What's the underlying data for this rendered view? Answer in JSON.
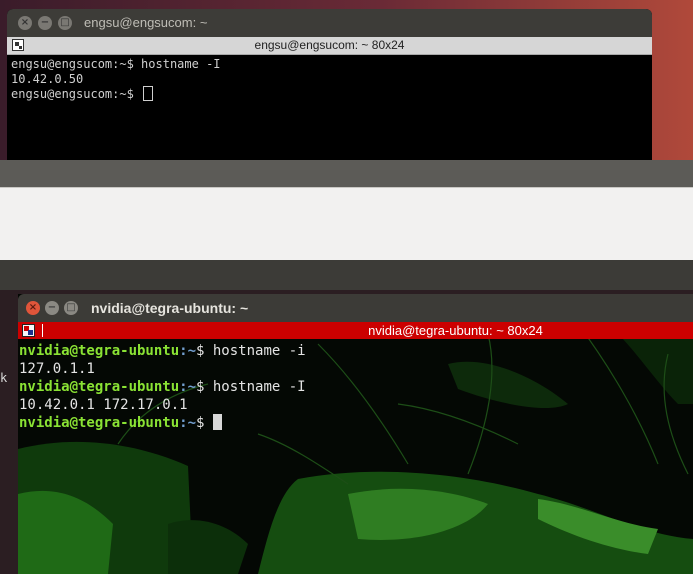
{
  "top_window": {
    "title": "engsu@engsucom: ~",
    "tab_title": "engsu@engsucom: ~ 80x24",
    "buttons": {
      "close": "×",
      "minimize": "−",
      "maximize": "□"
    },
    "lines": [
      {
        "prompt": "engsu@engsucom:~$ ",
        "command": "hostname -I"
      },
      {
        "output": "10.42.0.50"
      },
      {
        "prompt": "engsu@engsucom:~$ ",
        "command": ""
      }
    ]
  },
  "bottom_window": {
    "title": "nvidia@tegra-ubuntu: ~",
    "tab_title": "nvidia@tegra-ubuntu: ~ 80x24",
    "buttons": {
      "close": "×",
      "minimize": "−",
      "maximize": "□"
    },
    "prompt_user": "nvidia@tegra-ubuntu",
    "prompt_path": ":~",
    "prompt_symbol": "$ ",
    "lines": [
      {
        "command": "hostname -i"
      },
      {
        "output": "127.0.1.1"
      },
      {
        "command": "hostname -I"
      },
      {
        "output": "10.42.0.1 172.17.0.1"
      },
      {
        "command": ""
      }
    ]
  },
  "stray_text": "k",
  "colors": {
    "prompt_user": "#8ae234",
    "prompt_path": "#729fcf",
    "active_tab_bar": "#cc0000",
    "close_button": "#e0553a"
  }
}
